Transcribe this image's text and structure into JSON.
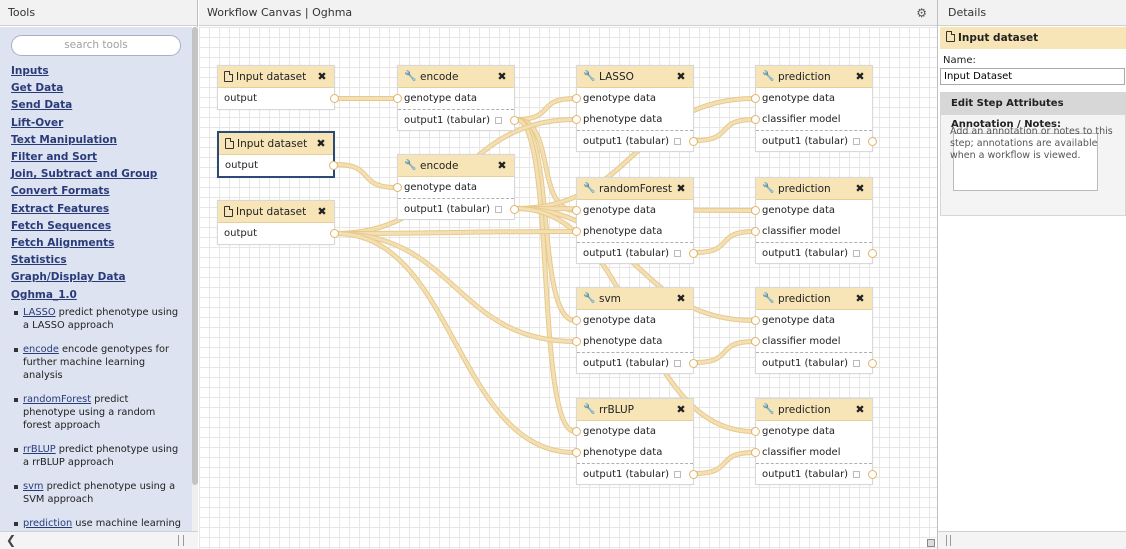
{
  "tools_panel": {
    "title": "Tools",
    "search_placeholder": "search tools",
    "sections": [
      "Inputs",
      "Get Data",
      "Send Data",
      "Lift-Over",
      "Text Manipulation",
      "Filter and Sort",
      "Join, Subtract and Group",
      "Convert Formats",
      "Extract Features",
      "Fetch Sequences",
      "Fetch Alignments",
      "Statistics",
      "Graph/Display Data",
      "Oghma_1.0"
    ],
    "tools": [
      {
        "link": "LASSO",
        "desc": " predict phenotype using a LASSO approach"
      },
      {
        "link": "encode",
        "desc": " encode genotypes for further machine learning analysis"
      },
      {
        "link": "randomForest",
        "desc": " predict phenotype using a random forest approach"
      },
      {
        "link": "rrBLUP",
        "desc": " predict phenotype using a rrBLUP approach"
      },
      {
        "link": "svm",
        "desc": " predict phenotype using a SVM approach"
      },
      {
        "link": "prediction",
        "desc": " use machine learning model to predict phenotype"
      }
    ]
  },
  "canvas": {
    "title": "Workflow Canvas | Oghma",
    "node_header_color": "#f7e4b7",
    "wire_color": "#f3dfb4",
    "nodes": [
      {
        "id": "in1",
        "title": "Input dataset",
        "icon": "document-icon",
        "inputs": [],
        "outputs": [
          "output"
        ]
      },
      {
        "id": "in2",
        "title": "Input dataset",
        "icon": "document-icon",
        "inputs": [],
        "outputs": [
          "output"
        ],
        "selected": true
      },
      {
        "id": "in3",
        "title": "Input dataset",
        "icon": "document-icon",
        "inputs": [],
        "outputs": [
          "output"
        ]
      },
      {
        "id": "enc1",
        "title": "encode",
        "icon": "wrench-icon",
        "inputs": [
          "genotype data"
        ],
        "outputs": [
          "output1 (tabular)"
        ]
      },
      {
        "id": "enc2",
        "title": "encode",
        "icon": "wrench-icon",
        "inputs": [
          "genotype data"
        ],
        "outputs": [
          "output1 (tabular)"
        ]
      },
      {
        "id": "lasso",
        "title": "LASSO",
        "icon": "wrench-icon",
        "inputs": [
          "genotype data",
          "phenotype data"
        ],
        "outputs": [
          "output1 (tabular)"
        ]
      },
      {
        "id": "rf",
        "title": "randomForest",
        "icon": "wrench-icon",
        "inputs": [
          "genotype data",
          "phenotype data"
        ],
        "outputs": [
          "output1 (tabular)"
        ]
      },
      {
        "id": "svm",
        "title": "svm",
        "icon": "wrench-icon",
        "inputs": [
          "genotype data",
          "phenotype data"
        ],
        "outputs": [
          "output1 (tabular)"
        ]
      },
      {
        "id": "rrblup",
        "title": "rrBLUP",
        "icon": "wrench-icon",
        "inputs": [
          "genotype data",
          "phenotype data"
        ],
        "outputs": [
          "output1 (tabular)"
        ]
      },
      {
        "id": "pred1",
        "title": "prediction",
        "icon": "wrench-icon",
        "inputs": [
          "genotype data",
          "classifier model"
        ],
        "outputs": [
          "output1 (tabular)"
        ]
      },
      {
        "id": "pred2",
        "title": "prediction",
        "icon": "wrench-icon",
        "inputs": [
          "genotype data",
          "classifier model"
        ],
        "outputs": [
          "output1 (tabular)"
        ]
      },
      {
        "id": "pred3",
        "title": "prediction",
        "icon": "wrench-icon",
        "inputs": [
          "genotype data",
          "classifier model"
        ],
        "outputs": [
          "output1 (tabular)"
        ]
      },
      {
        "id": "pred4",
        "title": "prediction",
        "icon": "wrench-icon",
        "inputs": [
          "genotype data",
          "classifier model"
        ],
        "outputs": [
          "output1 (tabular)"
        ]
      }
    ]
  },
  "details_panel": {
    "title": "Details",
    "step_title": "Input dataset",
    "name_label": "Name:",
    "name_value": "Input Dataset",
    "edit_header": "Edit Step Attributes",
    "annotation_label": "Annotation / Notes:",
    "annotation_help": "Add an annotation or notes to this step; annotations are available when a workflow is viewed."
  }
}
